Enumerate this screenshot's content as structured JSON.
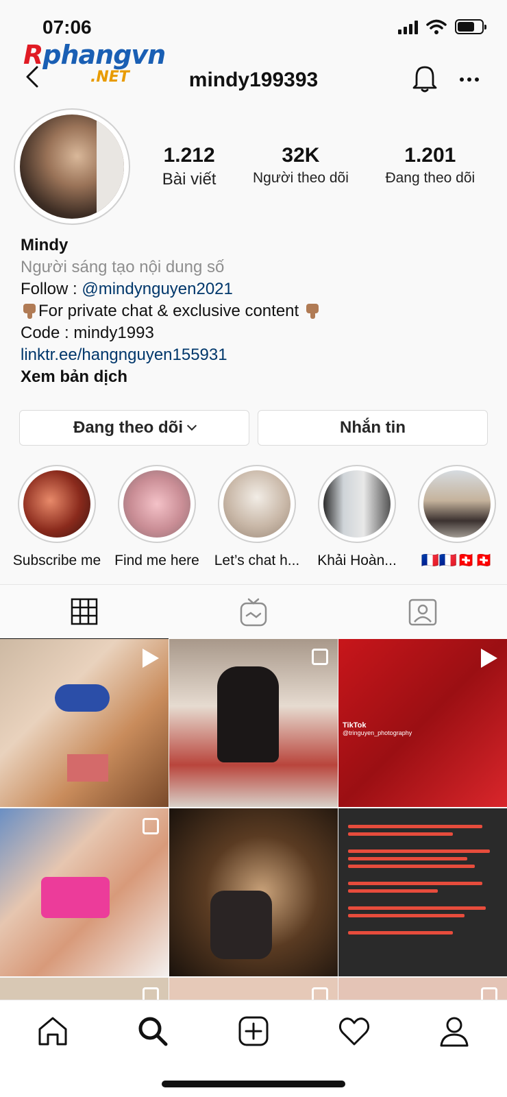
{
  "status_bar": {
    "time": "07:06"
  },
  "watermark": {
    "brand": "Rphangvn",
    "suffix": ".NET"
  },
  "header": {
    "username": "mindy199393"
  },
  "stats": [
    {
      "value": "1.212",
      "label": "Bài viết"
    },
    {
      "value": "32K",
      "label": "Người theo dõi"
    },
    {
      "value": "1.201",
      "label": "Đang theo dõi"
    }
  ],
  "bio": {
    "name": "Mindy",
    "category": "Người sáng tạo nội dung số",
    "follow_prefix": "Follow : ",
    "follow_handle": "@mindynguyen2021",
    "private_line": "For private chat & exclusive content",
    "code_line": "Code : mindy1993",
    "link": "linktr.ee/hangnguyen155931",
    "translate": "Xem bản dịch"
  },
  "actions": {
    "following": "Đang theo dõi",
    "message": "Nhắn tin"
  },
  "highlights": [
    {
      "label": "Subscribe me"
    },
    {
      "label": "Find me here"
    },
    {
      "label": "Let’s chat h..."
    },
    {
      "label": "Khải Hoàn..."
    },
    {
      "label": "🇫🇷🇫🇷🇨🇭🇨🇭"
    }
  ],
  "grid": {
    "tiktok": "TikTok",
    "tiktok_user": "@tringuyen_photography"
  },
  "colors": {
    "link": "#00376b",
    "muted": "#8e8e8e",
    "border": "#dbdbdb"
  },
  "icons": [
    "back-icon",
    "bell-icon",
    "more-icon",
    "grid-icon",
    "igtv-icon",
    "tagged-icon",
    "home-icon",
    "search-icon",
    "add-icon",
    "heart-icon",
    "profile-icon"
  ]
}
